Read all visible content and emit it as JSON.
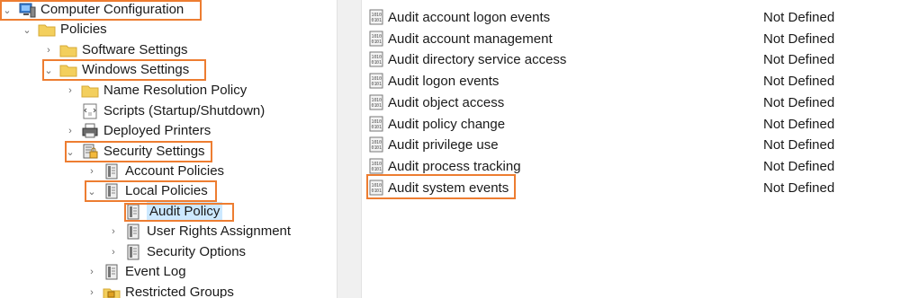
{
  "tree": {
    "computer_configuration": "Computer Configuration",
    "policies": "Policies",
    "software_settings": "Software Settings",
    "windows_settings": "Windows Settings",
    "name_resolution_policy": "Name Resolution Policy",
    "scripts": "Scripts (Startup/Shutdown)",
    "deployed_printers": "Deployed Printers",
    "security_settings": "Security Settings",
    "account_policies": "Account Policies",
    "local_policies": "Local Policies",
    "audit_policy": "Audit Policy",
    "user_rights_assignment": "User Rights Assignment",
    "security_options": "Security Options",
    "event_log": "Event Log",
    "restricted_groups": "Restricted Groups"
  },
  "policies": [
    {
      "name": "Audit account logon events",
      "setting": "Not Defined"
    },
    {
      "name": "Audit account management",
      "setting": "Not Defined"
    },
    {
      "name": "Audit directory service access",
      "setting": "Not Defined"
    },
    {
      "name": "Audit logon events",
      "setting": "Not Defined"
    },
    {
      "name": "Audit object access",
      "setting": "Not Defined"
    },
    {
      "name": "Audit policy change",
      "setting": "Not Defined"
    },
    {
      "name": "Audit privilege use",
      "setting": "Not Defined"
    },
    {
      "name": "Audit process tracking",
      "setting": "Not Defined"
    },
    {
      "name": "Audit system events",
      "setting": "Not Defined"
    }
  ],
  "colors": {
    "highlight": "#ed7d31",
    "selection": "#cce8ff",
    "folder": "#f3cf5d"
  }
}
